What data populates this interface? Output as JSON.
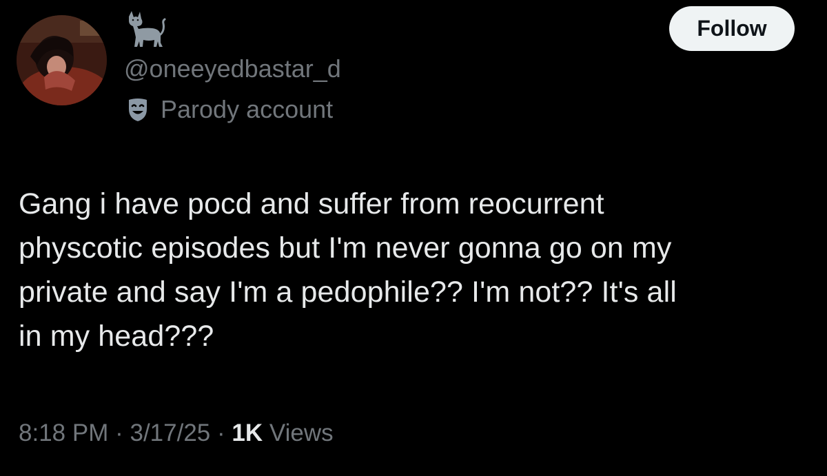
{
  "profile": {
    "display_name_emoji": "🐈",
    "handle": "@oneeyedbastar_d",
    "label_icon": "theater-mask-icon",
    "label_text": "Parody account"
  },
  "follow_button": {
    "label": "Follow"
  },
  "tweet": {
    "lines": [
      "Gang i have pocd and suffer from reocurrent",
      "physcotic episodes but I'm never gonna go on my",
      "private and say I'm a pedophile?? I'm not?? It's all",
      "in my head???"
    ]
  },
  "meta": {
    "time": "8:18 PM",
    "separator": "·",
    "date": "3/17/25",
    "views_count": "1K",
    "views_label": "Views"
  },
  "colors": {
    "background": "#000000",
    "primary_text": "#e7e9ea",
    "secondary_text": "#71767b",
    "button_bg": "#eff3f4",
    "button_text": "#0f1419"
  }
}
